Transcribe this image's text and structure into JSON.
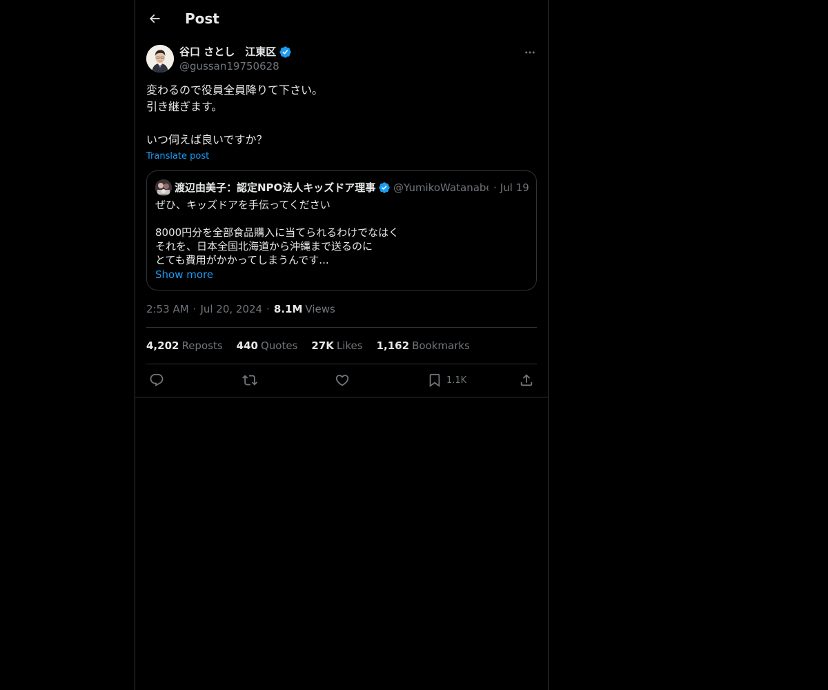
{
  "header": {
    "title": "Post"
  },
  "author": {
    "name": "谷口 さとし　江東区",
    "handle": "@gussan19750628"
  },
  "post": {
    "lines": [
      "変わるので役員全員降りて下さい。",
      "引き継ぎます。",
      "",
      "いつ伺えば良いですか？"
    ],
    "translate_label": "Translate post"
  },
  "quote": {
    "name": "渡辺由美子：認定NPO法人キッズドア理事長",
    "handle": "@YumikoWatanabe_",
    "separator": "·",
    "date": "Jul 19",
    "lines": [
      "ぜひ、キッズドアを手伝ってください",
      "",
      "8000円分を全部食品購入に当てられるわけでなはく",
      "それを、日本全国北海道から沖縄まで送るのに",
      "とても費用がかかってしまうんです..."
    ],
    "show_more": "Show more"
  },
  "meta": {
    "time": "2:53 AM",
    "separator": "·",
    "date": "Jul 20, 2024",
    "views_count": "8.1M",
    "views_label": "Views"
  },
  "stats": {
    "reposts_count": "4,202",
    "reposts_label": "Reposts",
    "quotes_count": "440",
    "quotes_label": "Quotes",
    "likes_count": "27K",
    "likes_label": "Likes",
    "bookmarks_count": "1,162",
    "bookmarks_label": "Bookmarks"
  },
  "actions": {
    "bookmark_count": "1.1K"
  },
  "colors": {
    "background": "#000000",
    "text": "#e7e9ea",
    "secondary_text": "#71767b",
    "accent": "#1d9bf0",
    "border": "#2f3336",
    "verified": "#1d9bf0"
  },
  "icons": {
    "back": "arrow-left-icon",
    "more": "more-horizontal-icon",
    "verified": "verified-badge-icon",
    "reply": "reply-icon",
    "repost": "repost-icon",
    "like": "heart-icon",
    "bookmark": "bookmark-icon",
    "share": "share-icon"
  }
}
